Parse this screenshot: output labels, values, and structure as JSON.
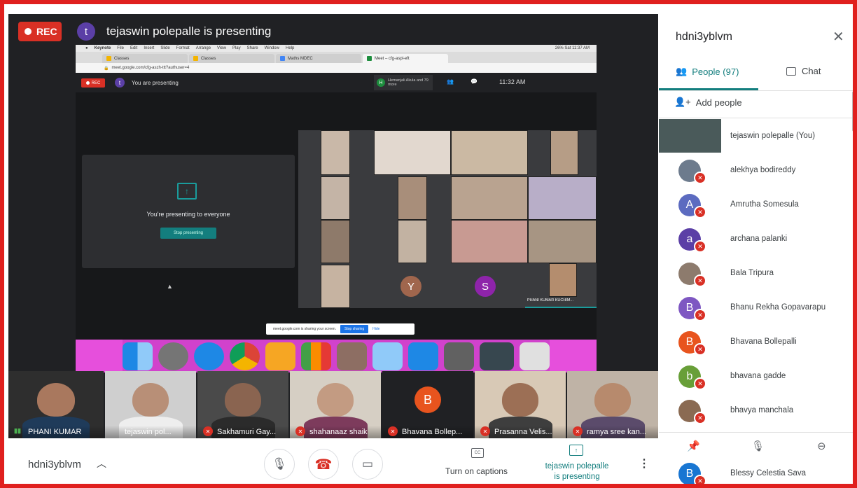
{
  "meeting": {
    "rec_label": "REC",
    "presenter_initial": "t",
    "presenter_title": "tejaswin polepalle is presenting",
    "code": "hdni3yblvm"
  },
  "shared_screen": {
    "menu_items": [
      "Keynote",
      "File",
      "Edit",
      "Insert",
      "Slide",
      "Format",
      "Arrange",
      "View",
      "Play",
      "Share",
      "Window",
      "Help"
    ],
    "menu_right": "26%  Sat 11:37 AM",
    "tabs": [
      "Classes",
      "Classes",
      "Maths MDEC",
      "Meet – cfg-aspl-eft"
    ],
    "address": "meet.google.com/cfg-aszh-ttt?authuser=4",
    "rec_label": "REC",
    "avatar_initial": "t",
    "you_presenting": "You are presenting",
    "participants_box": "Hemanjali Akula and 79 more",
    "participants_initial": "H",
    "clock": "11:32 AM",
    "card_text": "You're presenting to everyone",
    "card_button": "Stop presenting",
    "tile_y": "Y",
    "tile_s": "S",
    "tile_label": "PHANI KUMAR KUCHIM...",
    "share_notice": "meet.google.com is sharing your screen.",
    "share_stop": "Stop sharing",
    "share_hide": "Hide"
  },
  "filmstrip": [
    {
      "name": "PHANI KUMAR",
      "muted": false
    },
    {
      "name": "tejaswin pol...",
      "muted": false
    },
    {
      "name": "Sakhamuri Gay...",
      "muted": true
    },
    {
      "name": "shahanaaz shaik",
      "muted": true
    },
    {
      "name": "Bhavana Bollep...",
      "muted": true,
      "initial": "B"
    },
    {
      "name": "Prasanna Velis...",
      "muted": true
    },
    {
      "name": "ramya sree kan...",
      "muted": true
    }
  ],
  "controls": {
    "captions": "Turn on captions",
    "presenting_line1": "tejaswin polepalle",
    "presenting_line2": "is presenting"
  },
  "panel": {
    "title": "hdni3yblvm",
    "people_tab": "People (97)",
    "chat_tab": "Chat",
    "add_people": "Add people",
    "people": [
      {
        "name": "tejaswin polepalle (You)",
        "initial": "",
        "color": "#4a5a5a",
        "self": true
      },
      {
        "name": "alekhya bodireddy",
        "initial": "",
        "color": "#6d7b8d"
      },
      {
        "name": "Amrutha Somesula",
        "initial": "A",
        "color": "#5c6bc0"
      },
      {
        "name": "archana palanki",
        "initial": "a",
        "color": "#5b3fa6"
      },
      {
        "name": "Bala Tripura",
        "initial": "",
        "color": "#8d7b6d"
      },
      {
        "name": "Bhanu Rekha Gopavarapu",
        "initial": "B",
        "color": "#7e57c2"
      },
      {
        "name": "Bhavana Bollepalli",
        "initial": "B",
        "color": "#e8541e"
      },
      {
        "name": "bhavana gadde",
        "initial": "b",
        "color": "#689f38"
      },
      {
        "name": "bhavya manchala",
        "initial": "",
        "color": "#8a6a52"
      }
    ],
    "last_person": {
      "name": "Blessy Celestia Sava",
      "initial": "B",
      "color": "#1976d2"
    }
  },
  "colors": {
    "accent": "#137e7e",
    "record": "#d93025",
    "border": "#e0201e"
  }
}
